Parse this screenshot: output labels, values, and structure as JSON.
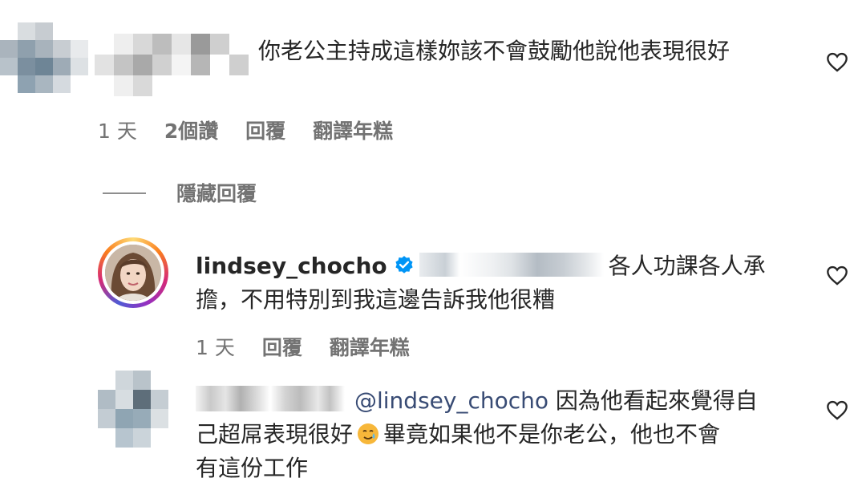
{
  "comment1": {
    "text": "你老公主持成這樣妳該不會鼓勵他說他表現很好",
    "time": "1 天",
    "likes": "2個讚",
    "reply": "回覆",
    "translate": "翻譯年糕"
  },
  "hidden_replies": {
    "label": "隱藏回覆"
  },
  "reply1": {
    "username": "lindsey_chocho",
    "line1": "各人功課各人承",
    "line2": "擔，不用特別到我這邊告訴我他很糟",
    "time": "1 天",
    "reply": "回覆",
    "translate": "翻譯年糕"
  },
  "reply2": {
    "mention": "@lindsey_chocho",
    "line1": "因為他看起來覺得自",
    "line2_a": "己超屌表現很好",
    "line2_b": "畢竟如果他不是你老公，他也不會",
    "line3": "有這份工作"
  },
  "icons": {
    "heart": "heart-outline-icon",
    "verified": "verified-badge-icon",
    "emoji": "smiling-face-with-tear-emoji"
  },
  "colors": {
    "text": "#262626",
    "secondary": "#737373",
    "mention": "#384b74",
    "verified": "#0095f6"
  }
}
